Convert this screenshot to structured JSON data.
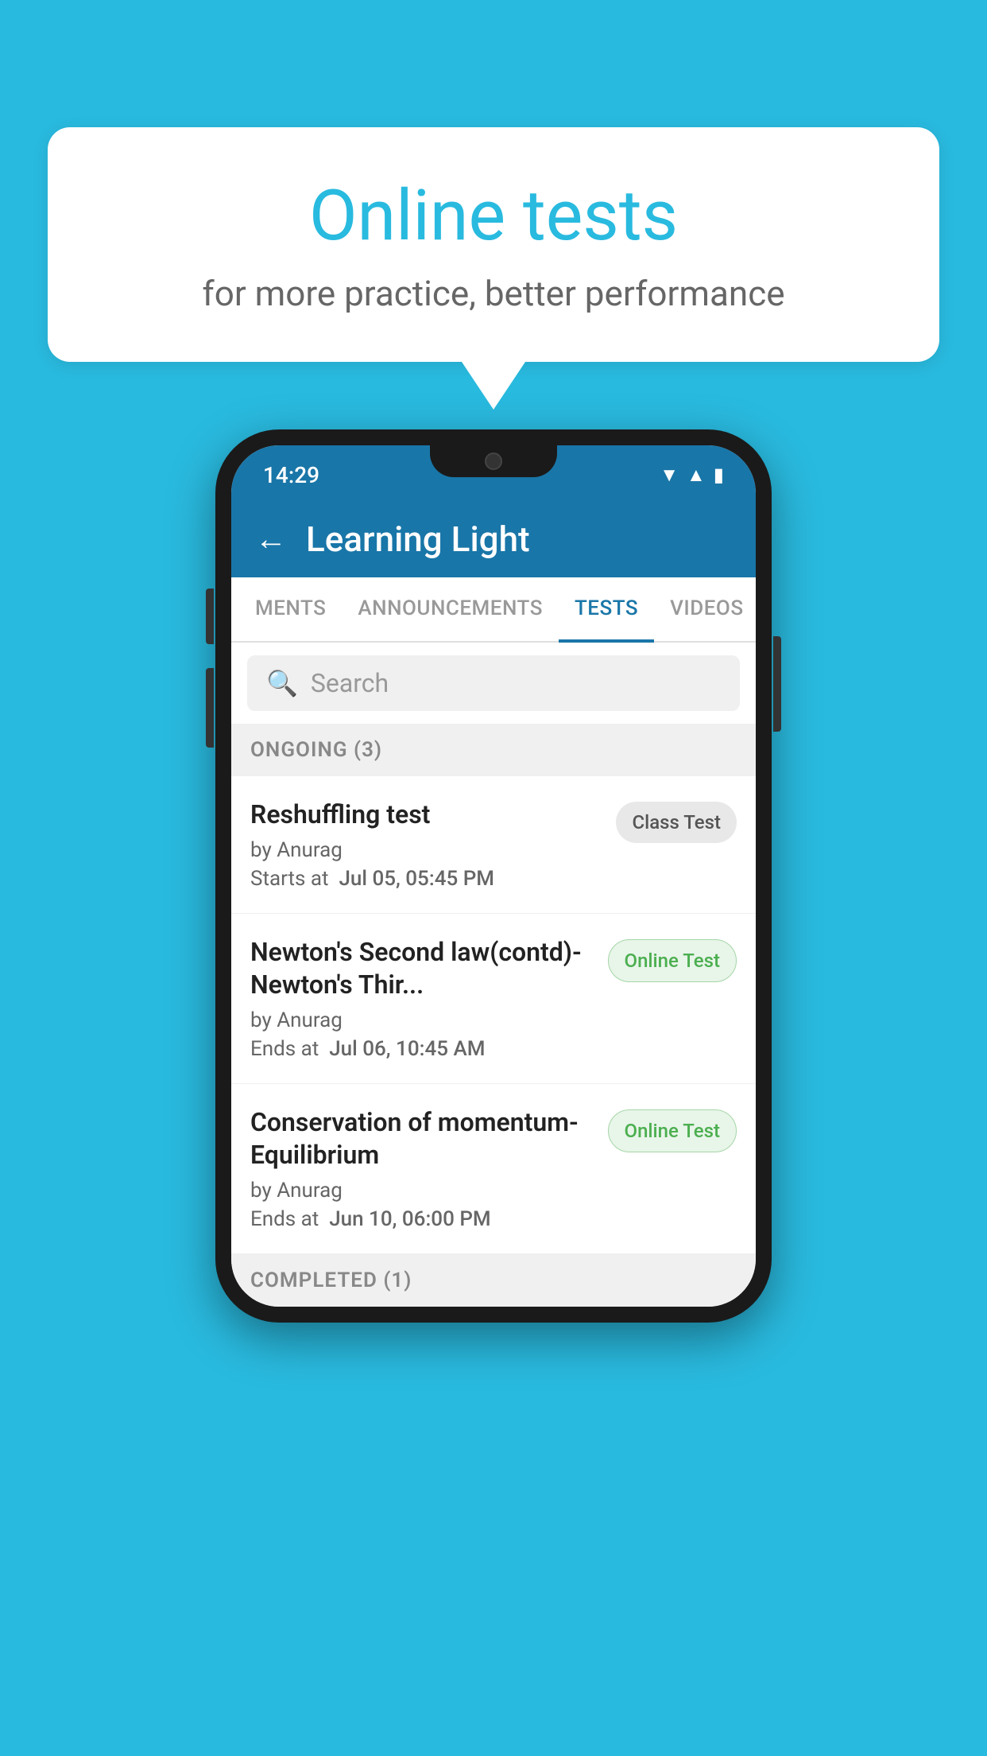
{
  "background_color": "#29BADF",
  "speech_bubble": {
    "title": "Online tests",
    "subtitle": "for more practice, better performance"
  },
  "phone": {
    "status_bar": {
      "time": "14:29",
      "icons": [
        "wifi",
        "signal",
        "battery"
      ]
    },
    "app_header": {
      "title": "Learning Light",
      "back_label": "←"
    },
    "tabs": [
      {
        "label": "MENTS",
        "active": false
      },
      {
        "label": "ANNOUNCEMENTS",
        "active": false
      },
      {
        "label": "TESTS",
        "active": true
      },
      {
        "label": "VIDEOS",
        "active": false
      }
    ],
    "search": {
      "placeholder": "Search"
    },
    "ongoing_section": {
      "label": "ONGOING (3)"
    },
    "test_items": [
      {
        "name": "Reshuffling test",
        "author": "by Anurag",
        "time_label": "Starts at",
        "time_value": "Jul 05, 05:45 PM",
        "badge": "Class Test",
        "badge_type": "class"
      },
      {
        "name": "Newton's Second law(contd)-Newton's Thir...",
        "author": "by Anurag",
        "time_label": "Ends at",
        "time_value": "Jul 06, 10:45 AM",
        "badge": "Online Test",
        "badge_type": "online"
      },
      {
        "name": "Conservation of momentum-Equilibrium",
        "author": "by Anurag",
        "time_label": "Ends at",
        "time_value": "Jun 10, 06:00 PM",
        "badge": "Online Test",
        "badge_type": "online"
      }
    ],
    "completed_section": {
      "label": "COMPLETED (1)"
    }
  }
}
